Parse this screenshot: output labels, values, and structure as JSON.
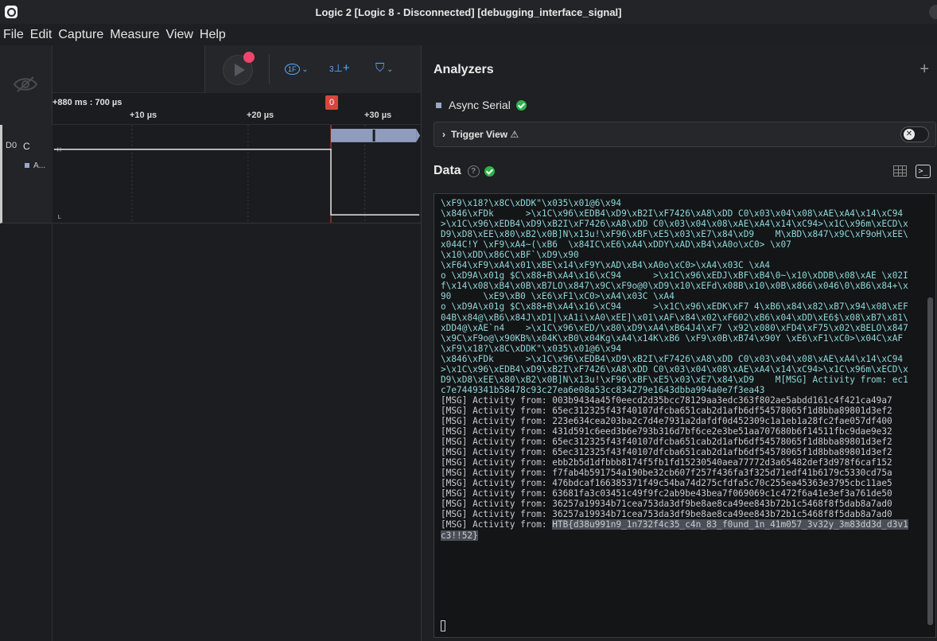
{
  "window": {
    "title": "Logic 2 [Logic 8 - Disconnected] [debugging_interface_signal]"
  },
  "menu": [
    "File",
    "Edit",
    "Capture",
    "Measure",
    "View",
    "Help"
  ],
  "toolbar": {
    "trigger_icon": "1F",
    "measure_icon": "3",
    "plus_label": "+",
    "markers_icon": "filter"
  },
  "ruler": {
    "main": "+880 ms : 700 µs",
    "ticks": [
      "+10 µs",
      "+20 µs",
      "+30 µs"
    ],
    "marker": "0"
  },
  "channel": {
    "id": "D0",
    "name": "C",
    "analyzer": "A...",
    "high": "H",
    "low": "L"
  },
  "analyzers": {
    "title": "Analyzers",
    "add": "+",
    "item": "Async Serial",
    "trigger_label": "Trigger View ⚠",
    "toggle_symbol": "✕"
  },
  "data": {
    "title": "Data",
    "help": "?",
    "terminal_icon": ">_",
    "lines": [
      "\\xF9\\x18?\\x8C\\xDDK\"\\x035\\x01@6\\x94",
      "\\x846\\xFDk      >\\x1C\\x96\\xEDB4\\xD9\\xB2I\\xF7426\\xA8\\xDD C0\\x03\\x04\\x08\\xAE\\xA4\\x14\\xC94",
      ">\\x1C\\x96\\xEDB4\\xD9\\xB2I\\xF7426\\xA8\\xDD C0\\x03\\x04\\x08\\xAE\\xA4\\x14\\xC94>\\x1C\\x96m\\xECD\\x",
      "D9\\xD8\\xEE\\x80\\xB2\\x0B]N\\x13u!\\xF96\\xBF\\xE5\\x03\\xE7\\x84\\xD9    M\\xBD\\x847\\x9C\\xF9oH\\xEE\\",
      "x044C!Y \\xF9\\xA4~(\\xB6  \\x84IC\\xE6\\xA4\\xDDY\\xAD\\xB4\\xA0o\\xC0> \\x07",
      "\\x10\\xDD\\x86C\\xBF`\\xD9\\x90",
      "\\xF64\\xF9\\xA4\\x01\\xBE\\x14\\xF9Y\\xAD\\xB4\\xA0o\\xC0>\\xA4\\x03C \\xA4",
      "o \\xD9A\\x01g $C\\x88+B\\xA4\\x16\\xC94      >\\x1C\\x96\\xEDJ\\xBF\\xB4\\0~\\x10\\xDDB\\x08\\xAE \\x02I",
      "f\\x14\\x08\\xB4\\x0B\\xB7LO\\x847\\x9C\\xF9o@0\\xD9\\x10\\xEFd\\x08B\\x10\\x0B\\x866\\x046\\0\\xB6\\x84+\\x",
      "90      \\xE9\\xB0 \\xE6\\xF1\\xC0>\\xA4\\x03C \\xA4",
      "o \\xD9A\\x01g $C\\x88+B\\xA4\\x16\\xC94      >\\x1C\\x96\\xEDK\\xF7 4\\xB6\\x84\\x82\\xB7\\x94\\x08\\xEF",
      "04B\\x84@\\xB6\\x84J\\xD1|\\xA1i\\xA0\\xEE]\\x01\\xAF\\x84\\x02\\xF602\\xB6\\x04\\xDD\\xE6$\\x08\\xB7\\x81\\",
      "xDD4@\\xAE`n4    >\\x1C\\x96\\xED/\\x80\\xD9\\xA4\\xB64J4\\xF7 \\x92\\x080\\xFD4\\xF75\\x02\\xBELO\\x847",
      "\\x9C\\xF9o@\\x90KB%\\x04K\\xB0\\x04Kg\\xA4\\x14K\\xB6 \\xF9\\x0B\\xB74\\x90Y \\xE6\\xF1\\xC0>\\x04C\\xAF",
      "\\xF9\\x18?\\x8C\\xDDK\"\\x035\\x01@6\\x94",
      "\\x846\\xFDk      >\\x1C\\x96\\xEDB4\\xD9\\xB2I\\xF7426\\xA8\\xDD C0\\x03\\x04\\x08\\xAE\\xA4\\x14\\xC94",
      ">\\x1C\\x96\\xEDB4\\xD9\\xB2I\\xF7426\\xA8\\xDD C0\\x03\\x04\\x08\\xAE\\xA4\\x14\\xC94>\\x1C\\x96m\\xECD\\x",
      "D9\\xD8\\xEE\\x80\\xB2\\x0B]N\\x13u!\\xF96\\xBF\\xE5\\x03\\xE7\\x84\\xD9    M[MSG] Activity from: ec1",
      "c7e7449341b58478c93c27ea6e08a53cc834279e1643dbba994a0e7f3ea43",
      "[MSG] Activity from: 003b9434a45f0eecd2d35bcc78129aa3edc363f802ae5abdd161c4f421ca49a7",
      "[MSG] Activity from: 65ec312325f43f40107dfcba651cab2d1afb6df54578065f1d8bba89801d3ef2",
      "[MSG] Activity from: 223e634cea203ba2c7d4e7931a2dafdf0d452309c1a1eb1a28fc2fae057df400",
      "[MSG] Activity from: 431d591c6eed3b6e793b316d7bf6ce2e3be51aa707680b6f14511fbc9dae9e32",
      "[MSG] Activity from: 65ec312325f43f40107dfcba651cab2d1afb6df54578065f1d8bba89801d3ef2",
      "[MSG] Activity from: 65ec312325f43f40107dfcba651cab2d1afb6df54578065f1d8bba89801d3ef2",
      "[MSG] Activity from: ebb2b5d1dfbbb8174f5fb1fd15230540aea77772d3a65482def3d978f6caf152",
      "[MSG] Activity from: f7fab4b591754a190be32cb607f257f436fa3f325d71edf41b6179c5330cd75a",
      "[MSG] Activity from: 476bdcaf166385371f49c54ba74d275cfdfa5c70c255ea45363e3795cbc11ae5",
      "[MSG] Activity from: 63681fa3c03451c49f9fc2ab9be43bea7f069069c1c472f6a41e3ef3a761de50",
      "[MSG] Activity from: 36257a19934b71cea753da3df9be8ae8ca49ee843b72b1c5468f8f5dab8a7ad0",
      "[MSG] Activity from: 36257a19934b71cea753da3df9be8ae8ca49ee843b72b1c5468f8f5dab8a7ad0"
    ],
    "last_prefix": "[MSG] Activity from: ",
    "last_highlight_1": "HTB{d38u991n9_1n732f4c35_c4n_83_f0und_1n_41m057_3v32y_3m83dd3d_d3v1",
    "last_highlight_2": "c3!!52}"
  },
  "colors": {
    "background": "#1b1c1f",
    "accent_blue": "#5fa8f5",
    "record_red": "#f0456b",
    "marker_red": "#d9453d",
    "success_green": "#2fb34a",
    "text_cyan": "#8fd8d9"
  }
}
